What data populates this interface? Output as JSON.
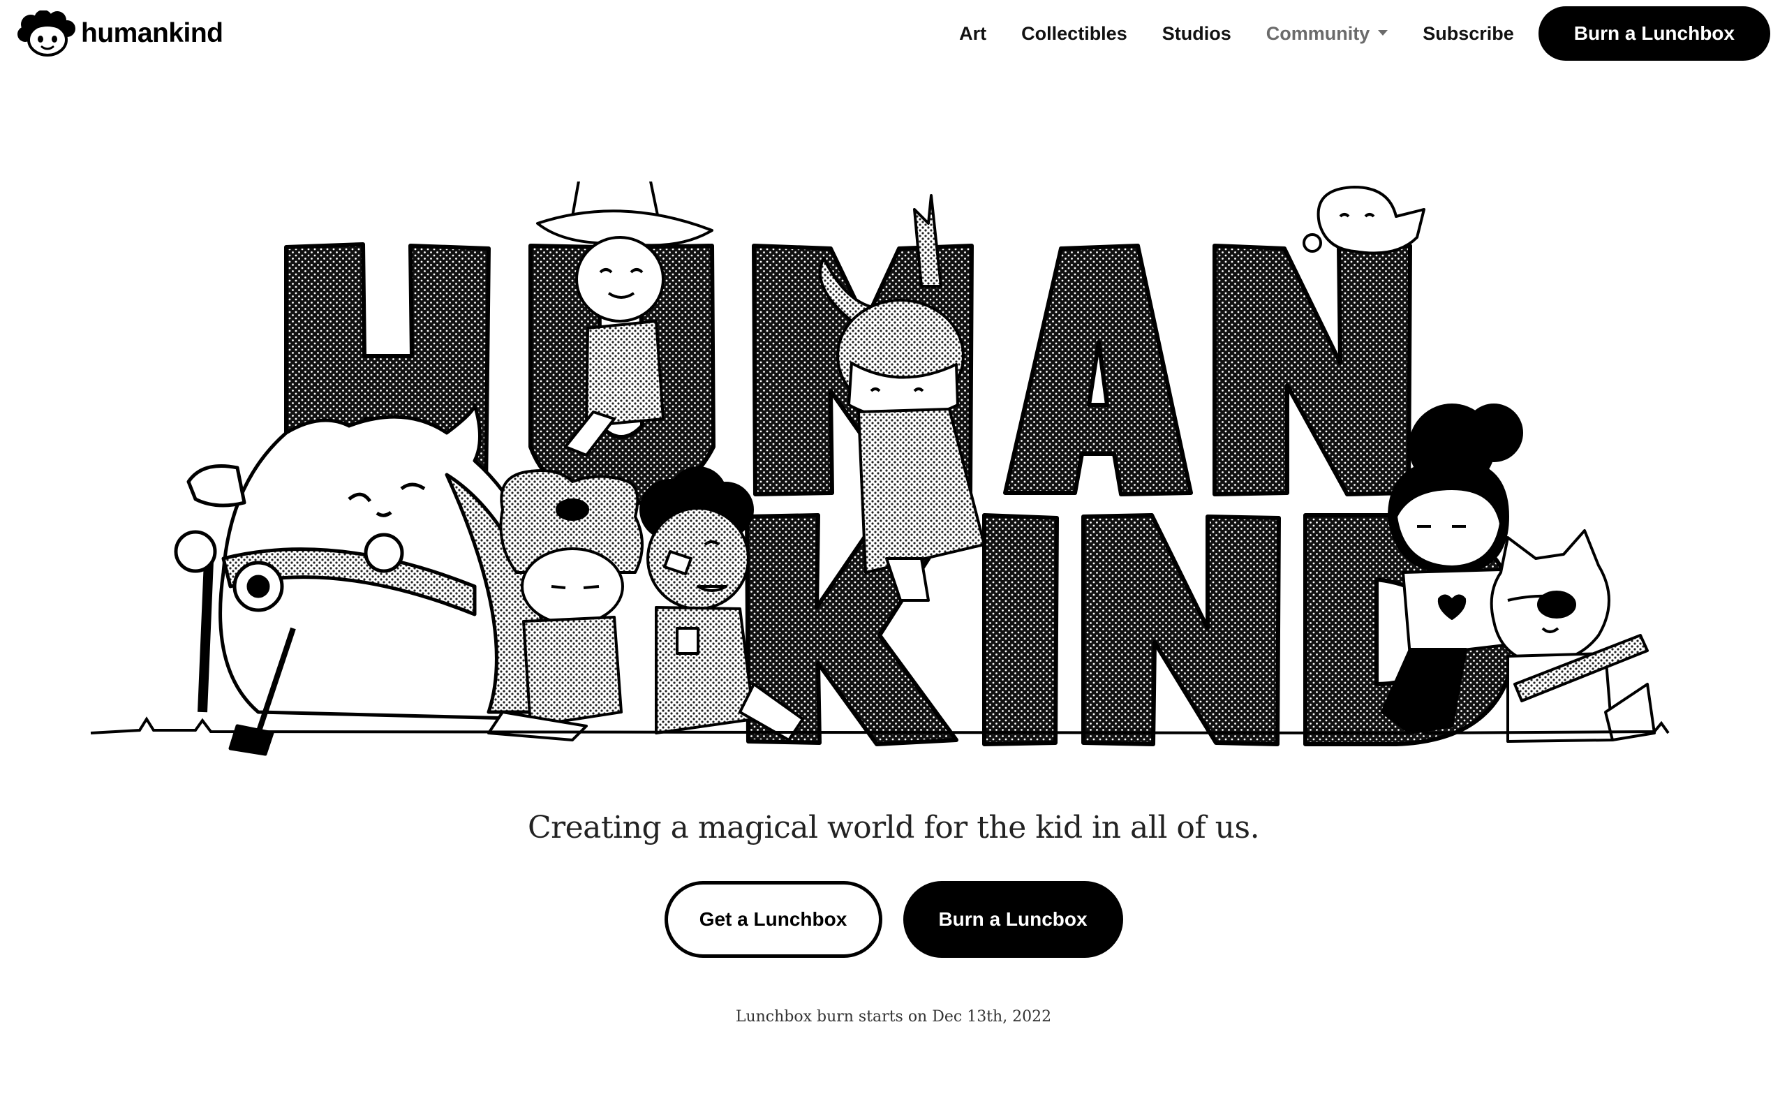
{
  "brand": {
    "name": "humankind",
    "logo_icon": "kid-face-logo-icon"
  },
  "nav": {
    "items": [
      {
        "label": "Art"
      },
      {
        "label": "Collectibles"
      },
      {
        "label": "Studios"
      },
      {
        "label": "Community",
        "has_dropdown": true
      },
      {
        "label": "Subscribe"
      }
    ],
    "cta_label": "Burn a Lunchbox"
  },
  "hero": {
    "title_line_1": "HUMAN",
    "title_line_2": "KIND",
    "ink_color": "#111111"
  },
  "tagline": "Creating a magical world for the kid in all of us.",
  "actions": {
    "get_label": "Get a Lunchbox",
    "burn_label": "Burn a Luncbox"
  },
  "note": "Lunchbox burn starts on Dec 13th, 2022"
}
